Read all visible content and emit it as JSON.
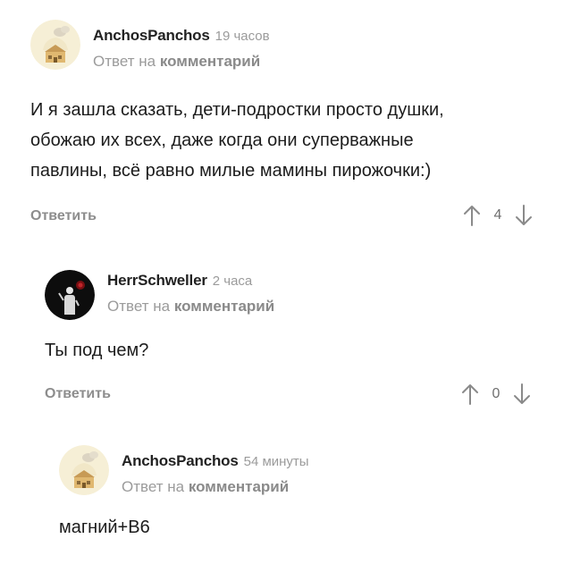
{
  "comments": [
    {
      "author": "AnchosPanchos",
      "time": "19 часов",
      "reply_prefix": "Ответ на",
      "reply_keyword": "комментарий",
      "body_lines": [
        "И я зашла сказать, дети-подростки просто душки,",
        "обожаю их всех, даже когда они суперважные",
        "павлины, всё равно милые мамины пирожочки:)"
      ],
      "reply_label": "Ответить",
      "votes": "4",
      "avatar": "cottage-avatar"
    },
    {
      "author": "HerrSchweller",
      "time": "2 часа",
      "reply_prefix": "Ответ на",
      "reply_keyword": "комментарий",
      "body_lines": [
        "Ты под чем?"
      ],
      "reply_label": "Ответить",
      "votes": "0",
      "avatar": "dark-figure-avatar"
    },
    {
      "author": "AnchosPanchos",
      "time": "54 минуты",
      "reply_prefix": "Ответ на",
      "reply_keyword": "комментарий",
      "body_lines": [
        "магний+B6"
      ],
      "avatar": "cottage-avatar"
    }
  ],
  "colors": {
    "muted_text": "#9b9b9b",
    "body_text": "#1c1c1c",
    "arrow": "#8a8a8a"
  },
  "icons": [
    "upvote-arrow-icon",
    "downvote-arrow-icon"
  ]
}
